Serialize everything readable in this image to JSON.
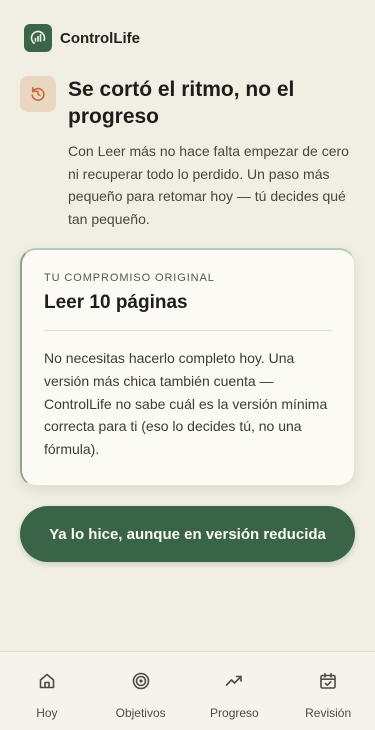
{
  "app": {
    "name": "ControlLife"
  },
  "intro": {
    "icon": "restart-icon",
    "title": "Se cortó el ritmo, no el progreso",
    "body": "Con Leer más no hace falta empezar de cero ni recuperar todo lo perdido. Un paso más pequeño para retomar hoy — tú decides qué tan pequeño."
  },
  "card": {
    "eyebrow": "TU COMPROMISO ORIGINAL",
    "title": "Leer 10 páginas",
    "body": "No necesitas hacerlo completo hoy. Una versión más chica también cuenta — ControlLife no sabe cuál es la versión mínima correcta para ti (eso lo decides tú, no una fórmula)."
  },
  "primary_action": {
    "label": "Ya lo hice, aunque en versión reducida"
  },
  "nav": {
    "items": [
      {
        "label": "Hoy",
        "icon": "home-icon"
      },
      {
        "label": "Objetivos",
        "icon": "target-icon"
      },
      {
        "label": "Progreso",
        "icon": "trending-up-icon"
      },
      {
        "label": "Revisión",
        "icon": "calendar-check-icon"
      }
    ]
  },
  "colors": {
    "background": "#f1eee4",
    "accent": "#3a6448",
    "icon_badge": "#ebd7c1",
    "icon_accent": "#c26a3a",
    "card": "#fbfaf4"
  }
}
